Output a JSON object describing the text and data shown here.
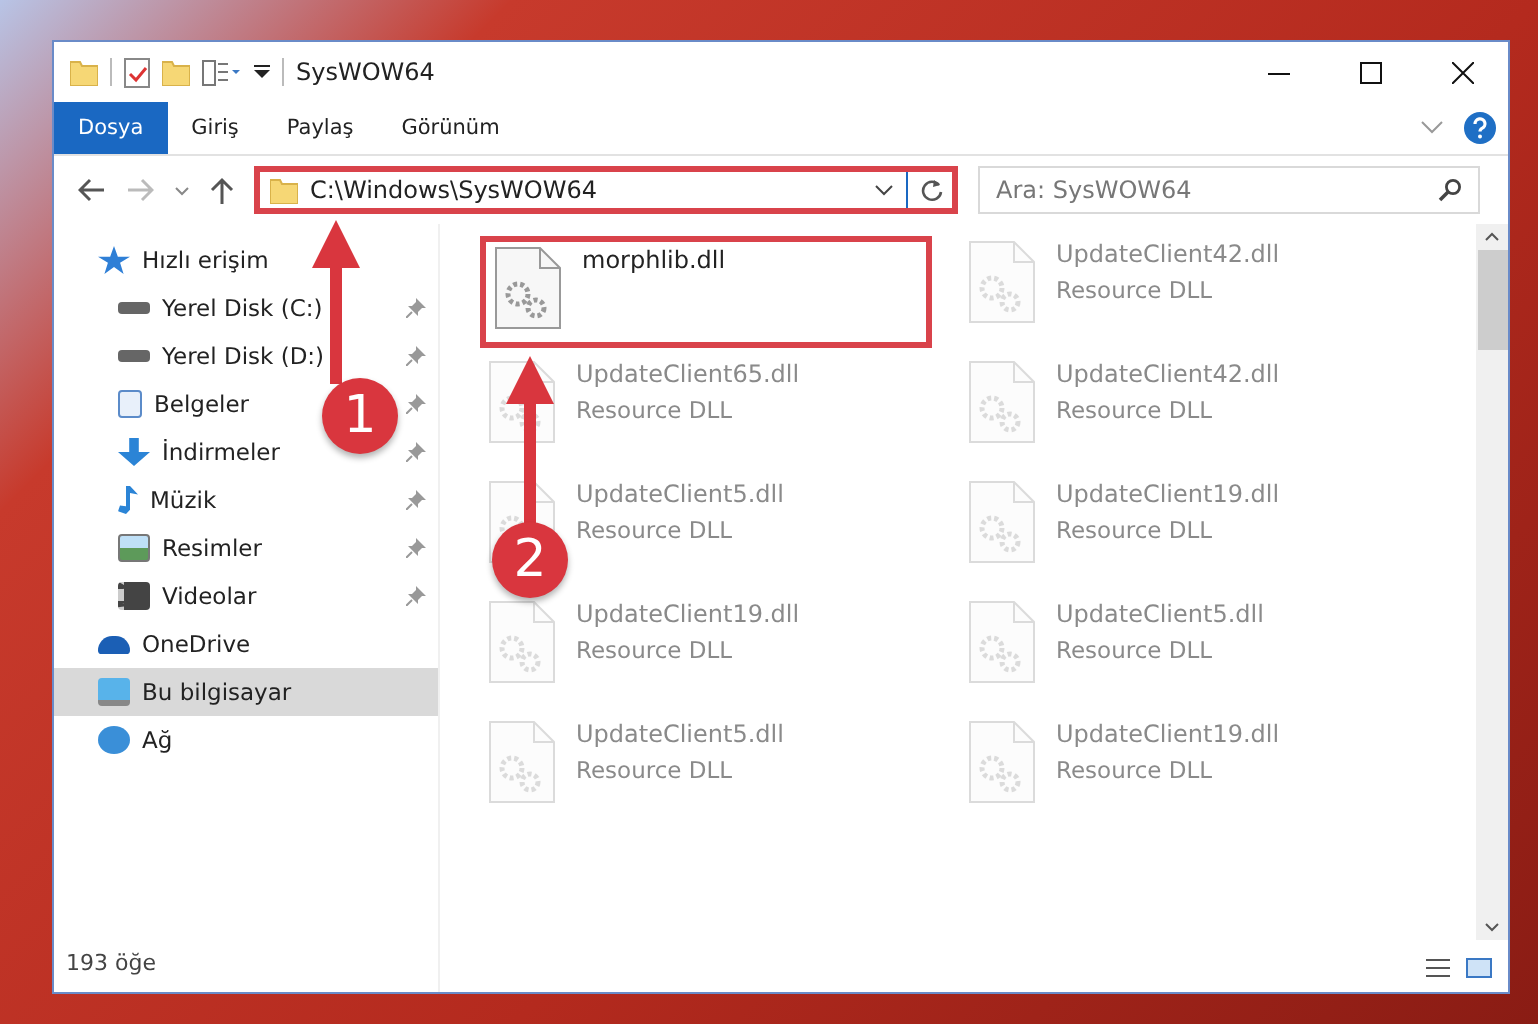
{
  "window": {
    "title": "SysWOW64"
  },
  "ribbon_tabs": [
    {
      "label": "Dosya",
      "selected": true
    },
    {
      "label": "Giriş",
      "selected": false
    },
    {
      "label": "Paylaş",
      "selected": false
    },
    {
      "label": "Görünüm",
      "selected": false
    }
  ],
  "address_bar": {
    "path": "C:\\Windows\\SysWOW64",
    "highlighted": true
  },
  "search": {
    "placeholder": "Ara: SysWOW64"
  },
  "sidebar": {
    "items": [
      {
        "label": "Hızlı erişim",
        "kind": "star",
        "selected": false,
        "children": [
          {
            "label": "Yerel Disk (C:)",
            "kind": "drive",
            "pinned": true,
            "selected": false
          },
          {
            "label": "Yerel Disk (D:)",
            "kind": "drive",
            "pinned": true,
            "selected": false
          },
          {
            "label": "Belgeler",
            "kind": "document",
            "pinned": true,
            "selected": false
          },
          {
            "label": "İndirmeler",
            "kind": "download",
            "pinned": true,
            "selected": false
          },
          {
            "label": "Müzik",
            "kind": "music",
            "pinned": true,
            "selected": false
          },
          {
            "label": "Resimler",
            "kind": "picture",
            "pinned": true,
            "selected": false
          },
          {
            "label": "Videolar",
            "kind": "video",
            "pinned": true,
            "selected": false
          }
        ]
      },
      {
        "label": "OneDrive",
        "kind": "cloud",
        "selected": false
      },
      {
        "label": "Bu bilgisayar",
        "kind": "computer",
        "selected": true
      },
      {
        "label": "Ağ",
        "kind": "network",
        "selected": false
      }
    ]
  },
  "files": [
    {
      "name": "morphlib.dll",
      "highlighted": true,
      "faded": false
    },
    {
      "name": "UpdateClient42.dll",
      "type": "Resource DLL",
      "highlighted": false,
      "faded": true
    },
    {
      "name": "UpdateClient65.dll",
      "type": "Resource DLL",
      "highlighted": false,
      "faded": true
    },
    {
      "name": "UpdateClient42.dll",
      "type": "Resource DLL",
      "highlighted": false,
      "faded": true
    },
    {
      "name": "UpdateClient5.dll",
      "type": "Resource DLL",
      "highlighted": false,
      "faded": true
    },
    {
      "name": "UpdateClient19.dll",
      "type": "Resource DLL",
      "highlighted": false,
      "faded": true
    },
    {
      "name": "UpdateClient19.dll",
      "type": "Resource DLL",
      "highlighted": false,
      "faded": true
    },
    {
      "name": "UpdateClient5.dll",
      "type": "Resource DLL",
      "highlighted": false,
      "faded": true
    },
    {
      "name": "UpdateClient5.dll",
      "type": "Resource DLL",
      "highlighted": false,
      "faded": true
    },
    {
      "name": "UpdateClient19.dll",
      "type": "Resource DLL",
      "highlighted": false,
      "faded": true
    }
  ],
  "status_bar": {
    "item_count": "193 öğe"
  },
  "step_markers": [
    {
      "label": "1"
    },
    {
      "label": "2"
    }
  ]
}
